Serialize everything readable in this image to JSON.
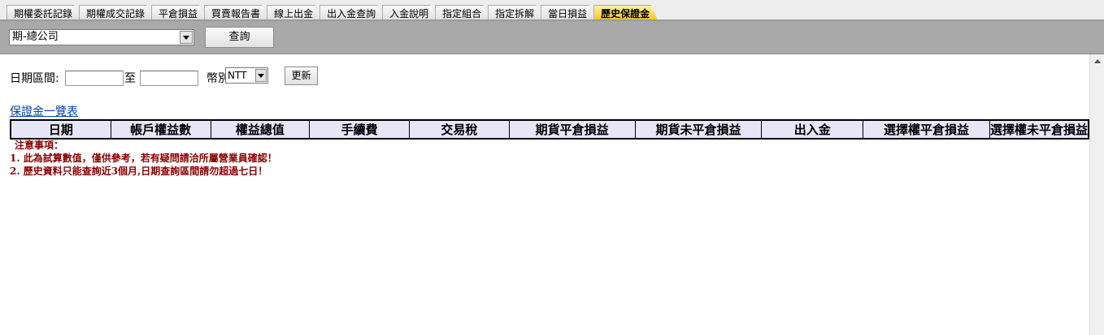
{
  "tabs": [
    {
      "label": "期權委託記錄",
      "active": false
    },
    {
      "label": "期權成交記錄",
      "active": false
    },
    {
      "label": "平倉損益",
      "active": false
    },
    {
      "label": "買賣報告書",
      "active": false
    },
    {
      "label": "線上出金",
      "active": false
    },
    {
      "label": "出入金查詢",
      "active": false
    },
    {
      "label": "入金說明",
      "active": false
    },
    {
      "label": "指定組合",
      "active": false
    },
    {
      "label": "指定拆解",
      "active": false
    },
    {
      "label": "當日損益",
      "active": false
    },
    {
      "label": "歷史保證金",
      "active": true
    }
  ],
  "toolbar": {
    "branch_value": "期-總公司",
    "query_label": "查詢"
  },
  "filter": {
    "date_range_label": "日期區間:",
    "date_from_value": "",
    "to_label": "至",
    "date_to_value": "",
    "currency_label": "幣別:",
    "currency_value": "NTT",
    "refresh_label": "更新"
  },
  "list_link": "保證金一覽表",
  "table": {
    "columns": [
      "日期",
      "帳戶權益數",
      "權益總值",
      "手續費",
      "交易稅",
      "期貨平倉損益",
      "期貨未平倉損益",
      "出入金",
      "選擇權平倉損益",
      "選擇權未平倉損益"
    ]
  },
  "notes": {
    "title": "注意事項：",
    "items": [
      "1. 此為試算數值，僅供參考，若有疑問請洽所屬營業員確認！",
      "2. 歷史資料只能查詢近3個月,日期查詢區間請勿超過七日！"
    ]
  },
  "colors": {
    "active_tab": "#f3c21e",
    "toolbar_bg": "#a9a9a9",
    "header_bg": "#e6e6f7",
    "note_text": "#8b0000",
    "link": "#0645ad"
  }
}
